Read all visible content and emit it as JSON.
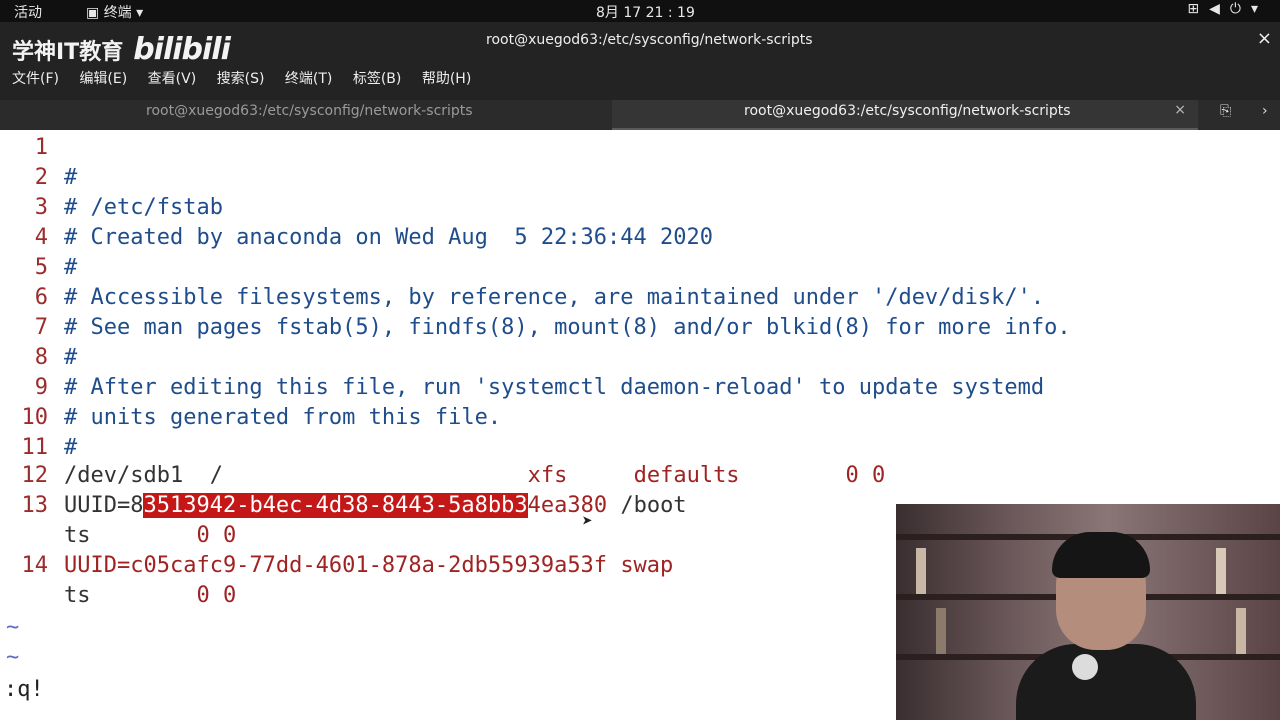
{
  "topbar": {
    "activities": "活动",
    "app_menu": "终端",
    "clock": "8月 17  21 : 19",
    "tray_icons": [
      "network-icon",
      "volume-icon",
      "power-icon"
    ]
  },
  "window": {
    "logo_text": "学神IT教育",
    "logo_bili": "bilibili",
    "title": "root@xuegod63:/etc/sysconfig/network-scripts",
    "close": "×"
  },
  "menubar": [
    "文件(F)",
    "编辑(E)",
    "查看(V)",
    "搜索(S)",
    "终端(T)",
    "标签(B)",
    "帮助(H)"
  ],
  "tabs": [
    {
      "label": "root@xuegod63:/etc/sysconfig/network-scripts",
      "active": false
    },
    {
      "label": "root@xuegod63:/etc/sysconfig/network-scripts",
      "active": true,
      "close": "×"
    }
  ],
  "editor": {
    "lines": [
      {
        "n": "1",
        "text": ""
      },
      {
        "n": "2",
        "text": "#"
      },
      {
        "n": "3",
        "text": "# /etc/fstab"
      },
      {
        "n": "4",
        "text": "# Created by anaconda on Wed Aug  5 22:36:44 2020"
      },
      {
        "n": "5",
        "text": "#"
      },
      {
        "n": "6",
        "text": "# Accessible filesystems, by reference, are maintained under '/dev/disk/'."
      },
      {
        "n": "7",
        "text": "# See man pages fstab(5), findfs(8), mount(8) and/or blkid(8) for more info."
      },
      {
        "n": "8",
        "text": "#"
      },
      {
        "n": "9",
        "text": "# After editing this file, run 'systemctl daemon-reload' to update systemd"
      },
      {
        "n": "10",
        "text": "# units generated from this file."
      },
      {
        "n": "11",
        "text": "#"
      }
    ],
    "line12": {
      "n": "12",
      "device": "/dev/sdb1",
      "mount": "/",
      "fstype": "xfs",
      "opts": "defaults",
      "dump": "0 0"
    },
    "line13": {
      "n": "13",
      "prefix": "UUID=8",
      "selected": "3513942-b4ec-4d38-8443-5a8bb3",
      "suffix": "4ea380",
      "mount": "/boot",
      "wrap": "ts",
      "dump": "0 0"
    },
    "line14": {
      "n": "14",
      "uuid": "UUID=c05cafc9-77dd-4601-878a-2db55939a53f",
      "mount": "swap",
      "wrap": "ts",
      "dump": "0 0"
    },
    "tilde": "~",
    "command": ":q!"
  }
}
